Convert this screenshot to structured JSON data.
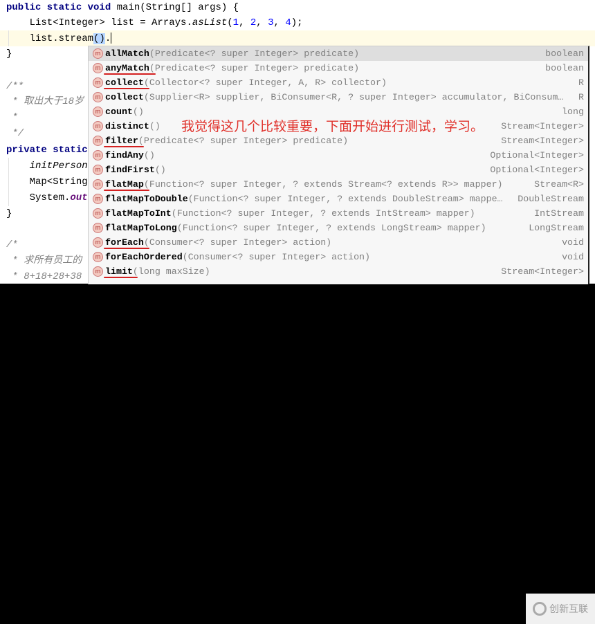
{
  "editor": {
    "lines": {
      "l1_kw": "public static void ",
      "l1_rest": "main(String[] args) {",
      "l2_a": "    List<Integer> list = Arrays.",
      "l2_fn": "asList",
      "l2_b": "(",
      "l2_n1": "1",
      "l2_c1": ", ",
      "l2_n2": "2",
      "l2_c2": ", ",
      "l2_n3": "3",
      "l2_c3": ", ",
      "l2_n4": "4",
      "l2_end": ");",
      "l3_a": "    list.stream",
      "l3_sel": "()",
      "l3_b": ".",
      "l4": "}",
      "l5": "/**",
      "l6": " * 取出大于18岁",
      "l7": " *",
      "l8": " */",
      "l9_kw": "private static",
      "l10": "    initPerson(",
      "l11": "    Map<String,",
      "l12_a": "    System.",
      "l12_f": "out",
      "l13": "}",
      "l14": "/*",
      "l15": " * 求所有员工的",
      "l16": " * 8+18+28+38"
    }
  },
  "popup": {
    "icon_letter": "m",
    "items": [
      {
        "name": "allMatch",
        "sig": "(Predicate<? super Integer> predicate)",
        "ret": "boolean",
        "selected": true,
        "underlined": false
      },
      {
        "name": "anyMatch",
        "sig": "(Predicate<? super Integer> predicate)",
        "ret": "boolean",
        "underlined": true
      },
      {
        "name": "collect",
        "sig": "(Collector<? super Integer, A, R> collector)",
        "ret": "R",
        "underlined": true
      },
      {
        "name": "collect",
        "sig": "(Supplier<R> supplier, BiConsumer<R, ? super Integer> accumulator, BiConsum…",
        "ret": "R",
        "underlined": false
      },
      {
        "name": "count",
        "sig": "()",
        "ret": "long",
        "underlined": false
      },
      {
        "name": "distinct",
        "sig": "()",
        "ret": "Stream<Integer>",
        "underlined": false
      },
      {
        "name": "filter",
        "sig": "(Predicate<? super Integer> predicate)",
        "ret": "Stream<Integer>",
        "underlined": true
      },
      {
        "name": "findAny",
        "sig": "()",
        "ret": "Optional<Integer>",
        "underlined": false
      },
      {
        "name": "findFirst",
        "sig": "()",
        "ret": "Optional<Integer>",
        "underlined": false
      },
      {
        "name": "flatMap",
        "sig": "(Function<? super Integer, ? extends Stream<? extends R>> mapper)",
        "ret": "Stream<R>",
        "underlined": true
      },
      {
        "name": "flatMapToDouble",
        "sig": "(Function<? super Integer, ? extends DoubleStream> mappe…",
        "ret": "DoubleStream",
        "underlined": false
      },
      {
        "name": "flatMapToInt",
        "sig": "(Function<? super Integer, ? extends IntStream> mapper)",
        "ret": "IntStream",
        "underlined": false
      },
      {
        "name": "flatMapToLong",
        "sig": "(Function<? super Integer, ? extends LongStream> mapper)",
        "ret": "LongStream",
        "underlined": false
      },
      {
        "name": "forEach",
        "sig": "(Consumer<? super Integer> action)",
        "ret": "void",
        "underlined": true
      },
      {
        "name": "forEachOrdered",
        "sig": "(Consumer<? super Integer> action)",
        "ret": "void",
        "underlined": false
      },
      {
        "name": "limit",
        "sig": "(long maxSize)",
        "ret": "Stream<Integer>",
        "underlined": true
      }
    ]
  },
  "annotation": "我觉得这几个比较重要，下面开始进行测试，学习。",
  "watermark": "创新互联",
  "colors": {
    "annotation": "#e0302a",
    "underline": "#d42020",
    "selected_row": "#dedede",
    "current_line": "#fffbe6"
  }
}
